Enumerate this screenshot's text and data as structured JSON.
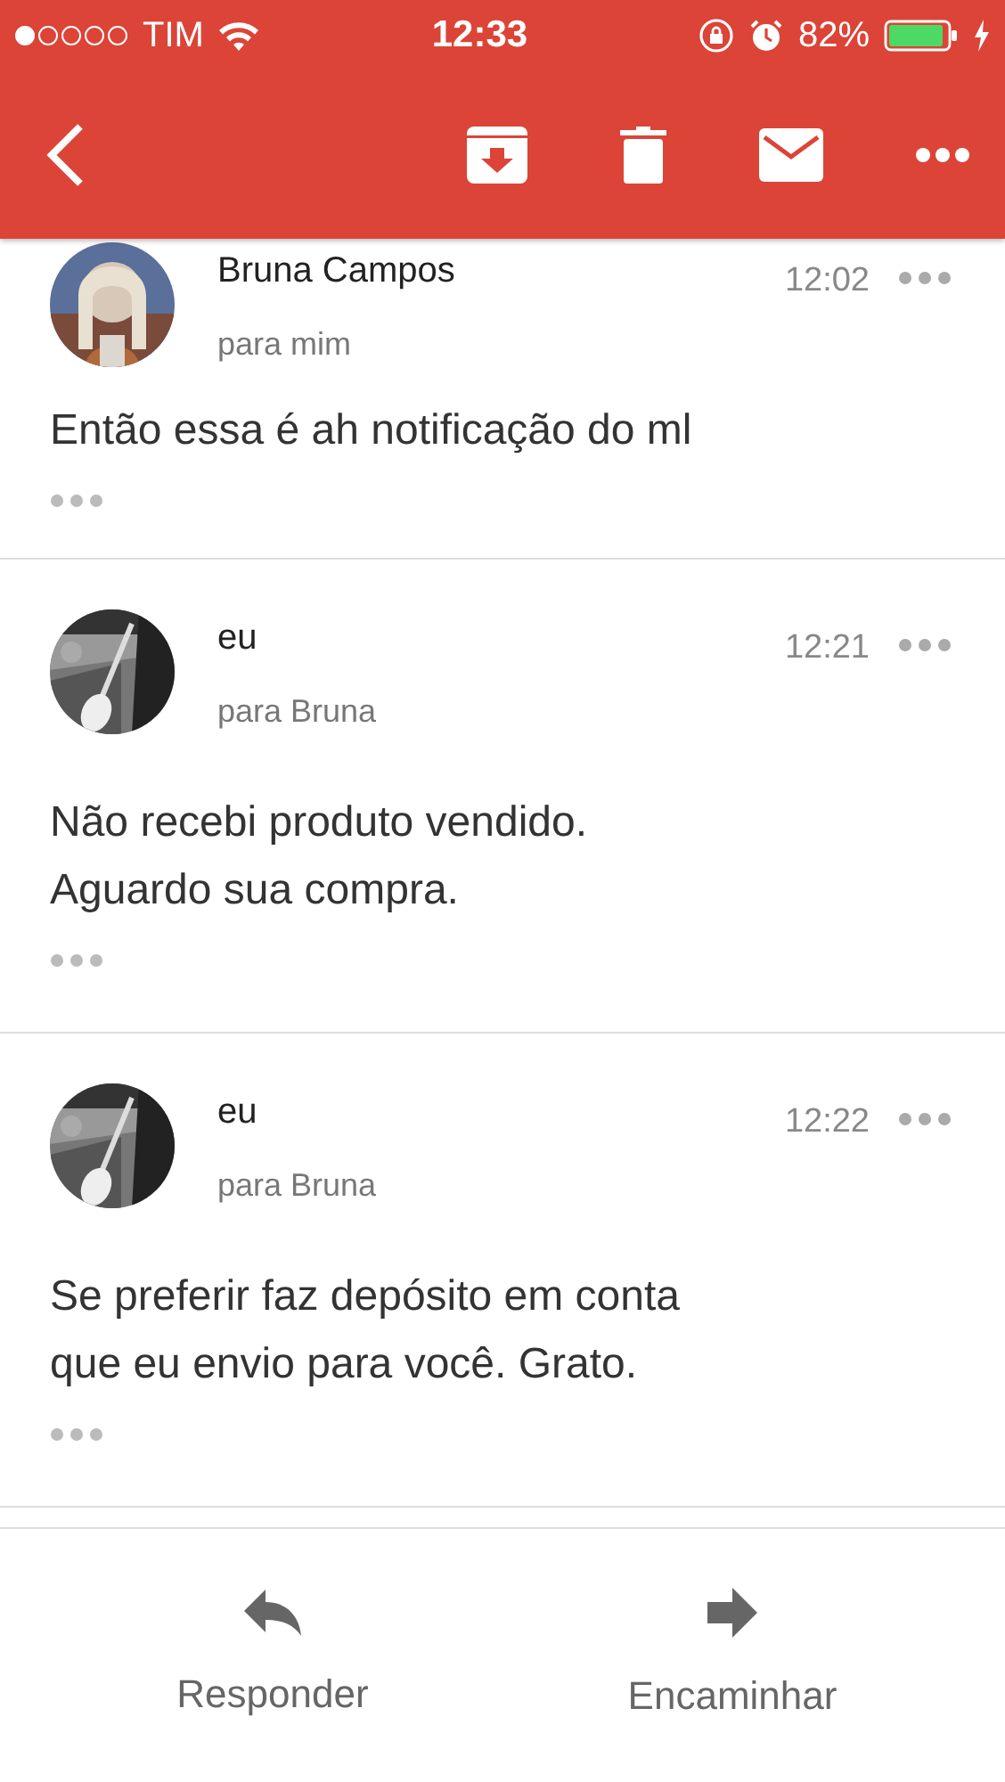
{
  "status_bar": {
    "carrier": "TIM",
    "time": "12:33",
    "battery": "82%"
  },
  "messages": [
    {
      "sender": "Bruna Campos",
      "recipient": "para mim",
      "time": "12:02",
      "body": [
        "Então essa é ah notificação do ml"
      ]
    },
    {
      "sender": "eu",
      "recipient": "para Bruna",
      "time": "12:21",
      "body": [
        "Não recebi produto vendido.",
        "Aguardo sua compra."
      ]
    },
    {
      "sender": "eu",
      "recipient": "para Bruna",
      "time": "12:22",
      "body": [
        "Se preferir faz depósito em conta",
        "que eu envio para você. Grato."
      ]
    }
  ],
  "actions": [
    {
      "label": "Responder",
      "kind": "reply"
    },
    {
      "label": "Encaminhar",
      "kind": "forward"
    }
  ]
}
